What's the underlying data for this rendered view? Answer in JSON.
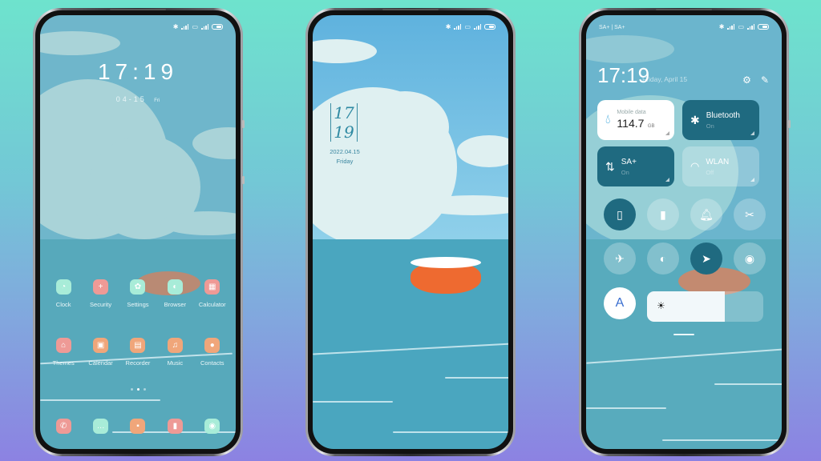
{
  "colors": {
    "bg_top": "#6ee3cd",
    "bg_bottom": "#8c82e2",
    "tile_active": "#1f6a80",
    "icon_mint": "#a8ecd8",
    "icon_pink": "#ee9a96",
    "icon_orange": "#f0a67a"
  },
  "status_bar": {
    "icons": [
      "bluetooth-icon",
      "signal-4g-icon",
      "hd-icon",
      "signal-4g-icon",
      "battery-icon"
    ]
  },
  "phone_home": {
    "time": "17:19",
    "date": "04-15",
    "day": "Fri",
    "apps_row1": [
      {
        "label": "Clock",
        "icon": "clock-icon",
        "glyph": "◔",
        "color": "#a8ecd8"
      },
      {
        "label": "Security",
        "icon": "security-icon",
        "glyph": "+",
        "color": "#ee9a96"
      },
      {
        "label": "Settings",
        "icon": "settings-icon",
        "glyph": "✿",
        "color": "#a8ecd8"
      },
      {
        "label": "Browser",
        "icon": "browser-icon",
        "glyph": "◐",
        "color": "#a8ecd8"
      },
      {
        "label": "Calculator",
        "icon": "calculator-icon",
        "glyph": "▦",
        "color": "#ee9a96"
      }
    ],
    "apps_row2": [
      {
        "label": "Themes",
        "icon": "themes-icon",
        "glyph": "⌂",
        "color": "#ee9a96"
      },
      {
        "label": "Calendar",
        "icon": "calendar-icon",
        "glyph": "▣",
        "color": "#f0a67a"
      },
      {
        "label": "Recorder",
        "icon": "recorder-icon",
        "glyph": "▤",
        "color": "#f0a67a"
      },
      {
        "label": "Music",
        "icon": "music-icon",
        "glyph": "♫",
        "color": "#f0a67a"
      },
      {
        "label": "Contacts",
        "icon": "contacts-icon",
        "glyph": "●",
        "color": "#f0a67a"
      }
    ],
    "page_dots": 3,
    "active_page": 2,
    "dock": [
      {
        "icon": "phone-icon",
        "glyph": "✆",
        "color": "#ee9a96"
      },
      {
        "icon": "messages-icon",
        "glyph": "…",
        "color": "#a8ecd8"
      },
      {
        "icon": "notes-icon",
        "glyph": "▪",
        "color": "#f0a67a"
      },
      {
        "icon": "books-icon",
        "glyph": "▮",
        "color": "#ee9a96"
      },
      {
        "icon": "camera-icon",
        "glyph": "◉",
        "color": "#a8ecd8"
      }
    ]
  },
  "phone_lock": {
    "hour": "17",
    "minute": "19",
    "date": "2022.04.15",
    "day": "Friday"
  },
  "phone_control": {
    "carrier": "SA+ | SA+",
    "time": "17:19",
    "date": "Friday, April 15",
    "tiles": {
      "mobile_data": {
        "label": "Mobile data",
        "value": "114.7",
        "unit": "GB"
      },
      "bluetooth": {
        "label": "Bluetooth",
        "status": "On"
      },
      "sa": {
        "label": "SA+",
        "status": "On"
      },
      "wlan": {
        "label": "WLAN",
        "status": "Off"
      }
    },
    "toggles_row1": [
      {
        "name": "vibrate-toggle",
        "icon": "vibrate-icon",
        "glyph": "▯",
        "on": true
      },
      {
        "name": "flashlight-toggle",
        "icon": "flashlight-icon",
        "glyph": "▮",
        "on": false
      },
      {
        "name": "bell-toggle",
        "icon": "bell-icon",
        "glyph": "🔔︎",
        "on": false
      },
      {
        "name": "screenshot-toggle",
        "icon": "scissors-icon",
        "glyph": "✂",
        "on": false
      }
    ],
    "toggles_row2": [
      {
        "name": "airplane-toggle",
        "icon": "airplane-icon",
        "glyph": "✈",
        "on": false
      },
      {
        "name": "dark-mode-toggle",
        "icon": "contrast-icon",
        "glyph": "◐",
        "on": false
      },
      {
        "name": "location-toggle",
        "icon": "location-icon",
        "glyph": "➤",
        "on": true
      },
      {
        "name": "reading-mode-toggle",
        "icon": "eye-icon",
        "glyph": "◉",
        "on": false
      }
    ],
    "auto_brightness_label": "A",
    "brightness_percent": 67
  }
}
